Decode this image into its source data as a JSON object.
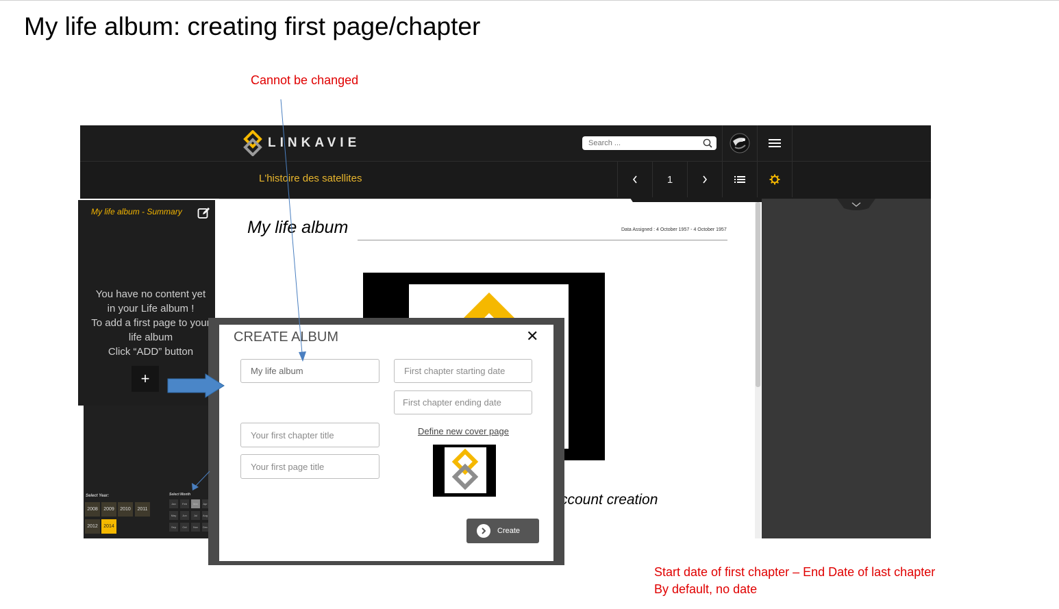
{
  "slide": {
    "title": "My life album: creating first page/chapter",
    "note_top": "Cannot be changed",
    "note_bottom_1": "Start date of first chapter – End Date of last chapter",
    "note_bottom_2": "By default, no date"
  },
  "app": {
    "logo_text": "LINKAVIE",
    "search_placeholder": "Search ...",
    "album_name": "L'histoire des satellites",
    "page_number": "1",
    "accent_color": "#f5b800"
  },
  "sidebar": {
    "title": "My life album - Summary",
    "empty_line_1": "You have no content yet",
    "empty_line_2": "in your Life album !",
    "empty_line_3": "To add a first page to your",
    "empty_line_4": "life album",
    "empty_line_5": "Click “ADD” button",
    "add_label": "+",
    "select_year_label": "Select Year:",
    "select_month_label": "Select Month",
    "years": [
      "2008",
      "2009",
      "2010",
      "2011",
      "2012",
      "2014"
    ],
    "months": [
      "Jan",
      "Feb",
      "Mar",
      "Apr",
      "May",
      "Jun",
      "Jul",
      "Aug",
      "Sep",
      "Oct",
      "Nov",
      "Dec"
    ]
  },
  "page": {
    "title": "My life album",
    "dates_assigned": "Data Assigned : 4 October 1957 - 4 October 1957",
    "partial_caption": "ccount creation"
  },
  "modal": {
    "title": "CREATE ALBUM",
    "close_label": "✕",
    "album_name_value": "My life album",
    "chapter_start_placeholder": "First chapter starting date",
    "chapter_end_placeholder": "First chapter ending date",
    "chapter_title_placeholder": "Your first chapter title",
    "page_title_placeholder": "Your first page title",
    "define_cover_label": "Define new cover page",
    "create_label": "Create"
  }
}
